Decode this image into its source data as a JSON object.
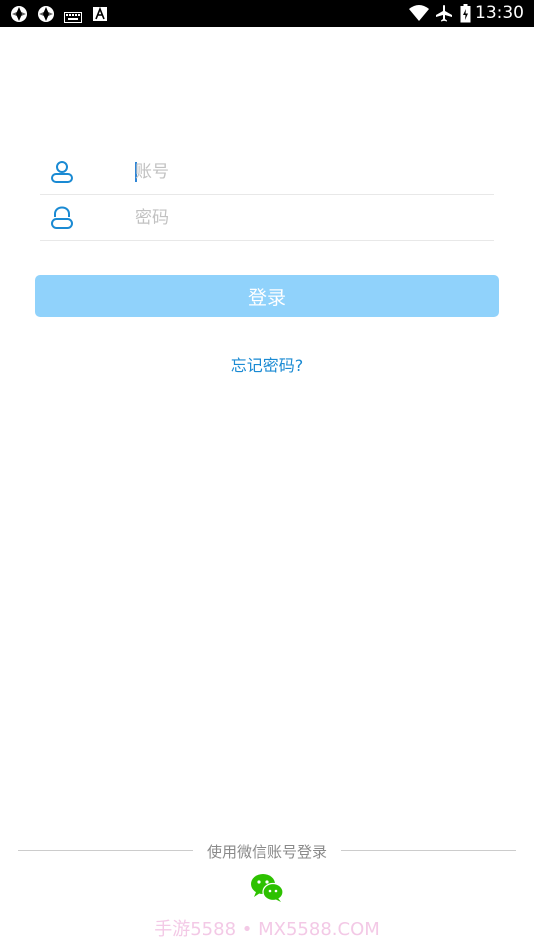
{
  "status_bar": {
    "time": "13:30",
    "left_icons": [
      "app-notification-icon",
      "app-notification-icon",
      "keyboard-icon",
      "text-a-icon"
    ],
    "right_icons": [
      "wifi-icon",
      "airplane-icon",
      "battery-icon"
    ]
  },
  "login_form": {
    "account": {
      "placeholder": "账号",
      "value": "",
      "icon": "user-icon"
    },
    "password": {
      "placeholder": "密码",
      "value": "",
      "icon": "lock-icon"
    },
    "login_button": "登录",
    "forgot_password": "忘记密码?"
  },
  "alt_login": {
    "divider_text": "使用微信账号登录",
    "wechat_icon": "wechat-icon"
  },
  "watermark": "手游5588 • MX5588.COM",
  "colors": {
    "accent": "#1a8ad3",
    "button_bg": "#90d2fb",
    "wechat": "#2dc100",
    "watermark": "#f3c9e6"
  }
}
